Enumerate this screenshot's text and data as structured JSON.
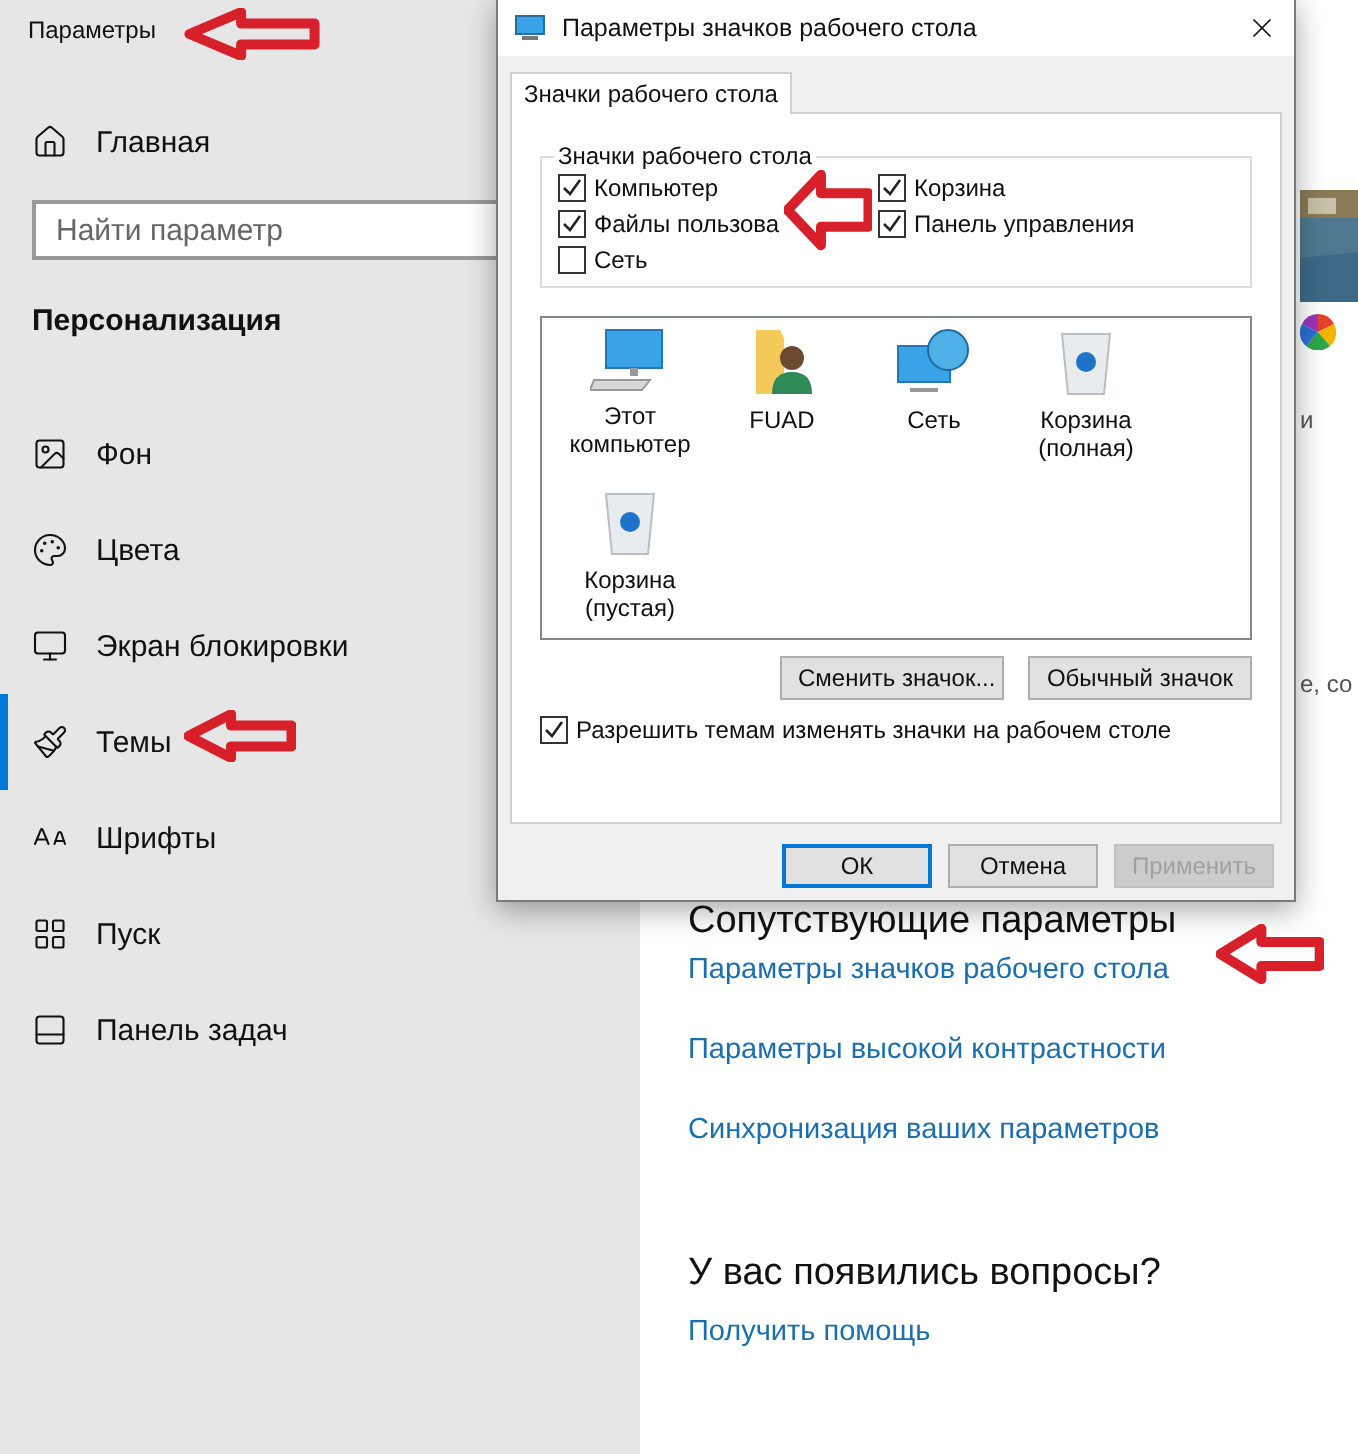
{
  "settings_window": {
    "title": "Параметры"
  },
  "sidebar": {
    "home": "Главная",
    "search": {
      "placeholder": "Найти параметр"
    },
    "section": "Персонализация",
    "items": [
      {
        "label": "Фон",
        "selected": false
      },
      {
        "label": "Цвета",
        "selected": false
      },
      {
        "label": "Экран блокировки",
        "selected": false
      },
      {
        "label": "Темы",
        "selected": true
      },
      {
        "label": "Шрифты",
        "selected": false
      },
      {
        "label": "Пуск",
        "selected": false
      },
      {
        "label": "Панель задач",
        "selected": false
      }
    ]
  },
  "content": {
    "fragments": [
      "и",
      "е, со"
    ],
    "related_heading": "Сопутствующие параметры",
    "links": [
      "Параметры значков рабочего стола",
      "Параметры высокой контрастности",
      "Синхронизация ваших параметров"
    ],
    "questions_heading": "У вас появились вопросы?",
    "help_link": "Получить помощь"
  },
  "dialog": {
    "title": "Параметры значков рабочего стола",
    "tabs": [
      {
        "label": "Значки рабочего стола",
        "selected": true
      }
    ],
    "group": {
      "title": "Значки рабочего стола",
      "checkboxes": [
        {
          "label": "Компьютер",
          "checked": true
        },
        {
          "label": "Корзина",
          "checked": true
        },
        {
          "label": "Файлы пользова",
          "checked": true
        },
        {
          "label": "Панель управления",
          "checked": true
        },
        {
          "label": "Сеть",
          "checked": false
        }
      ]
    },
    "icons": [
      {
        "label": "Этот компьютер",
        "kind": "computer"
      },
      {
        "label": "FUAD",
        "kind": "user"
      },
      {
        "label": "Сеть",
        "kind": "network"
      },
      {
        "label": "Корзина (полная)",
        "kind": "bin"
      },
      {
        "label": "Корзина (пустая)",
        "kind": "bin"
      }
    ],
    "icon_buttons": [
      "Сменить значок...",
      "Обычный значок"
    ],
    "allow_themes": {
      "label": "Разрешить темам изменять значки на рабочем столе",
      "checked": true
    },
    "footer_buttons": [
      {
        "label": "ОК",
        "kind": "default"
      },
      {
        "label": "Отмена",
        "kind": "normal"
      },
      {
        "label": "Применить",
        "kind": "disabled"
      }
    ]
  }
}
